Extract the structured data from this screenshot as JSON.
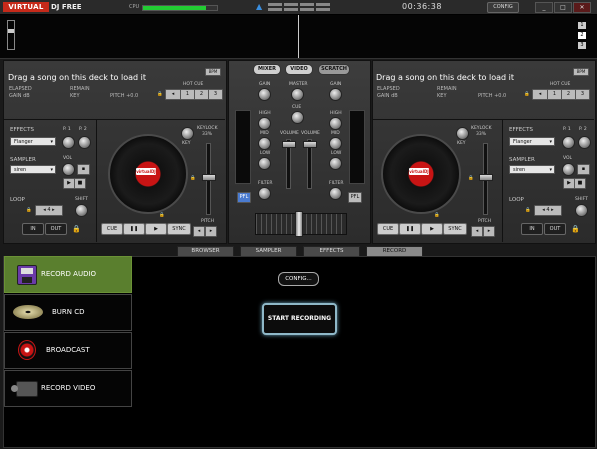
{
  "app": {
    "logo_text": "VIRTUAL",
    "logo_suffix": "DJ FREE"
  },
  "topbar": {
    "cpu_label": "CPU",
    "cpu_level": 0.85,
    "time": "00:36:38",
    "config_label": "CONFIG",
    "min_label": "_",
    "max_label": "□",
    "close_label": "✕"
  },
  "deck_numbers": [
    "1",
    "2",
    "3"
  ],
  "deckA": {
    "title": "Drag a song on this deck to load it",
    "bpm_label": "BPM",
    "elapsed": "ELAPSED",
    "remain": "REMAIN",
    "gain": "GAIN dB",
    "key": "KEY",
    "pitch": "PITCH +0.0",
    "hotcue_label": "HOT CUE",
    "hotcues": [
      "1",
      "2",
      "3"
    ],
    "effects_label": "EFFECTS",
    "p1": "P. 1",
    "p2": "P. 2",
    "effect_value": "Flanger",
    "sampler_label": "SAMPLER",
    "vol_label": "VOL",
    "sampler_value": "siren",
    "loop_label": "LOOP",
    "shift_label": "SHIFT",
    "loop_value": "4",
    "in_label": "IN",
    "out_label": "OUT",
    "keylock_label": "KEYLOCK",
    "keylock_pct": "33%",
    "key_small": "KEY",
    "pitch_small": "PITCH",
    "cue": "CUE",
    "pause": "❚❚",
    "play": "▶",
    "sync": "SYNC",
    "platter_label": "virtualDJ"
  },
  "deckB": {
    "title": "Drag a song on this deck to load it",
    "bpm_label": "BPM",
    "elapsed": "ELAPSED",
    "remain": "REMAIN",
    "gain": "GAIN dB",
    "key": "KEY",
    "pitch": "PITCH +0.0",
    "hotcue_label": "HOT CUE",
    "hotcues": [
      "1",
      "2",
      "3"
    ],
    "effects_label": "EFFECTS",
    "p1": "P. 1",
    "p2": "P. 2",
    "effect_value": "Flanger",
    "sampler_label": "SAMPLER",
    "vol_label": "VOL",
    "sampler_value": "siren",
    "loop_label": "LOOP",
    "shift_label": "SHIFT",
    "loop_value": "4",
    "in_label": "IN",
    "out_label": "OUT",
    "keylock_label": "KEYLOCK",
    "keylock_pct": "33%",
    "key_small": "KEY",
    "pitch_small": "PITCH",
    "cue": "CUE",
    "pause": "❚❚",
    "play": "▶",
    "sync": "SYNC",
    "platter_label": "virtualDJ"
  },
  "mixer": {
    "tabs": [
      "MIXER",
      "VIDEO",
      "SCRATCH"
    ],
    "gain": "GAIN",
    "master": "MASTER",
    "cue": "CUE",
    "high": "HIGH",
    "mid": "MID",
    "low": "LOW",
    "volume": "VOLUME",
    "filter": "FILTER",
    "pfl": "PFL"
  },
  "bottom_tabs": [
    "BROWSER",
    "SAMPLER",
    "EFFECTS",
    "RECORD"
  ],
  "active_tab": "RECORD",
  "record": {
    "items": [
      {
        "label": "RECORD AUDIO",
        "icon": "floppy-disk-icon"
      },
      {
        "label": "BURN CD",
        "icon": "cd-icon"
      },
      {
        "label": "BROADCAST",
        "icon": "broadcast-icon"
      },
      {
        "label": "RECORD VIDEO",
        "icon": "video-camera-icon"
      }
    ],
    "config_label": "CONFIG...",
    "start_label": "START RECORDING"
  },
  "colors": {
    "accent_red": "#c81414",
    "active_green": "#5a7f2e",
    "cpu_green": "#22cc33"
  }
}
